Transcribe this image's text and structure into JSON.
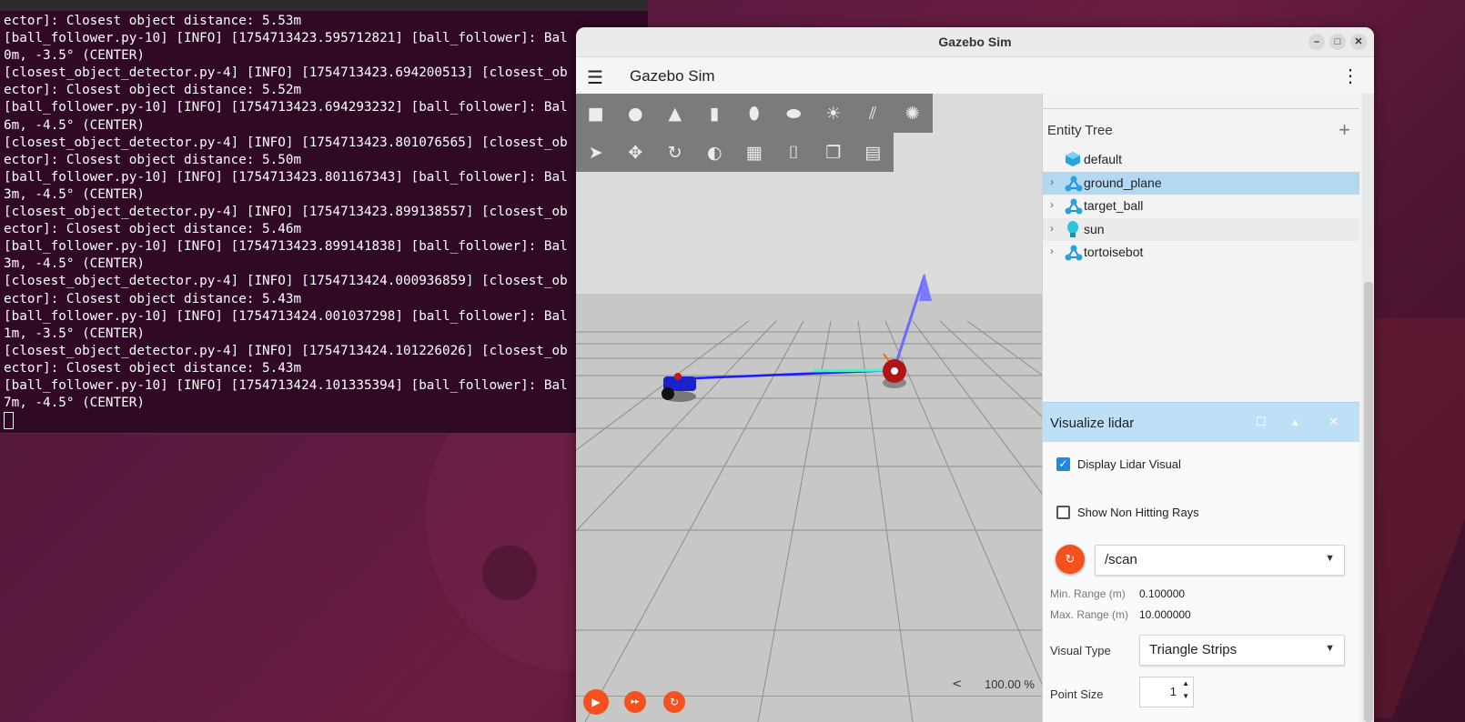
{
  "terminal": {
    "lines": [
      "ector]: Closest object distance: 5.53m",
      "[ball_follower.py-10] [INFO] [1754713423.595712821] [ball_follower]: Bal",
      "0m, -3.5° (CENTER)",
      "[closest_object_detector.py-4] [INFO] [1754713423.694200513] [closest_ob",
      "ector]: Closest object distance: 5.52m",
      "[ball_follower.py-10] [INFO] [1754713423.694293232] [ball_follower]: Bal",
      "6m, -4.5° (CENTER)",
      "[closest_object_detector.py-4] [INFO] [1754713423.801076565] [closest_ob",
      "ector]: Closest object distance: 5.50m",
      "[ball_follower.py-10] [INFO] [1754713423.801167343] [ball_follower]: Bal",
      "3m, -4.5° (CENTER)",
      "[closest_object_detector.py-4] [INFO] [1754713423.899138557] [closest_ob",
      "ector]: Closest object distance: 5.46m",
      "[ball_follower.py-10] [INFO] [1754713423.899141838] [ball_follower]: Bal",
      "3m, -4.5° (CENTER)",
      "[closest_object_detector.py-4] [INFO] [1754713424.000936859] [closest_ob",
      "ector]: Closest object distance: 5.43m",
      "[ball_follower.py-10] [INFO] [1754713424.001037298] [ball_follower]: Bal",
      "1m, -3.5° (CENTER)",
      "[closest_object_detector.py-4] [INFO] [1754713424.101226026] [closest_ob",
      "ector]: Closest object distance: 5.43m",
      "[ball_follower.py-10] [INFO] [1754713424.101335394] [ball_follower]: Bal",
      "7m, -4.5° (CENTER)"
    ]
  },
  "window": {
    "title": "Gazebo Sim"
  },
  "appbar": {
    "name": "Gazebo Sim",
    "menu_glyph": "☰",
    "kebab_glyph": "⋮"
  },
  "viewport": {
    "shape_tools": [
      {
        "name": "box-icon",
        "glyph": "■"
      },
      {
        "name": "sphere-icon",
        "glyph": "●"
      },
      {
        "name": "cone-icon",
        "glyph": "▲"
      },
      {
        "name": "cylinder-icon",
        "glyph": "▮"
      },
      {
        "name": "capsule-icon",
        "glyph": "⬮"
      },
      {
        "name": "ellipsoid-icon",
        "glyph": "⬬"
      },
      {
        "name": "sun-light-icon",
        "glyph": "☀"
      },
      {
        "name": "directional-light-icon",
        "glyph": "⫽"
      },
      {
        "name": "spot-light-icon",
        "glyph": "✺"
      }
    ],
    "transform_tools": [
      {
        "name": "select-arrow-icon",
        "glyph": "➤"
      },
      {
        "name": "translate-icon",
        "glyph": "✥"
      },
      {
        "name": "rotate-icon",
        "glyph": "↻"
      },
      {
        "name": "snap-icon",
        "glyph": "◐"
      },
      {
        "name": "grid-icon",
        "glyph": "▦"
      },
      {
        "name": "camera-icon",
        "glyph": "⌷"
      },
      {
        "name": "copy-icon",
        "glyph": "❐"
      },
      {
        "name": "paste-icon",
        "glyph": "▤"
      }
    ],
    "play_glyph": "▶",
    "step_glyph": "▸▸",
    "reset_glyph": "↻",
    "rtf_arrow": "<",
    "rtf": "100.00 %"
  },
  "entity_tree": {
    "title": "Entity Tree",
    "add_glyph": "+",
    "items": [
      {
        "label": "default",
        "icon": "world-cube-icon",
        "expandable": false,
        "selected": false
      },
      {
        "label": "ground_plane",
        "icon": "model-icon",
        "expandable": true,
        "selected": true
      },
      {
        "label": "target_ball",
        "icon": "model-icon",
        "expandable": true,
        "selected": false
      },
      {
        "label": "sun",
        "icon": "light-bulb-icon",
        "expandable": true,
        "selected": false
      },
      {
        "label": "tortoisebot",
        "icon": "model-icon",
        "expandable": true,
        "selected": false
      }
    ]
  },
  "visualize_lidar": {
    "title": "Visualize lidar",
    "display_lidar_visual": "Display Lidar Visual",
    "display_checked": true,
    "show_non_hitting": "Show Non Hitting Rays",
    "non_hitting_checked": false,
    "topic": "/scan",
    "min_range_label": "Min. Range (m)",
    "min_range_value": "0.100000",
    "max_range_label": "Max. Range (m)",
    "max_range_value": "10.000000",
    "visual_type_label": "Visual Type",
    "visual_type_value": "Triangle Strips",
    "point_size_label": "Point Size",
    "point_size_value": "1"
  },
  "colors": {
    "accent": "#f4511e",
    "selection": "#b3d9f2",
    "panel_header": "#bee0f7",
    "terminal_bg": "#300a24"
  }
}
